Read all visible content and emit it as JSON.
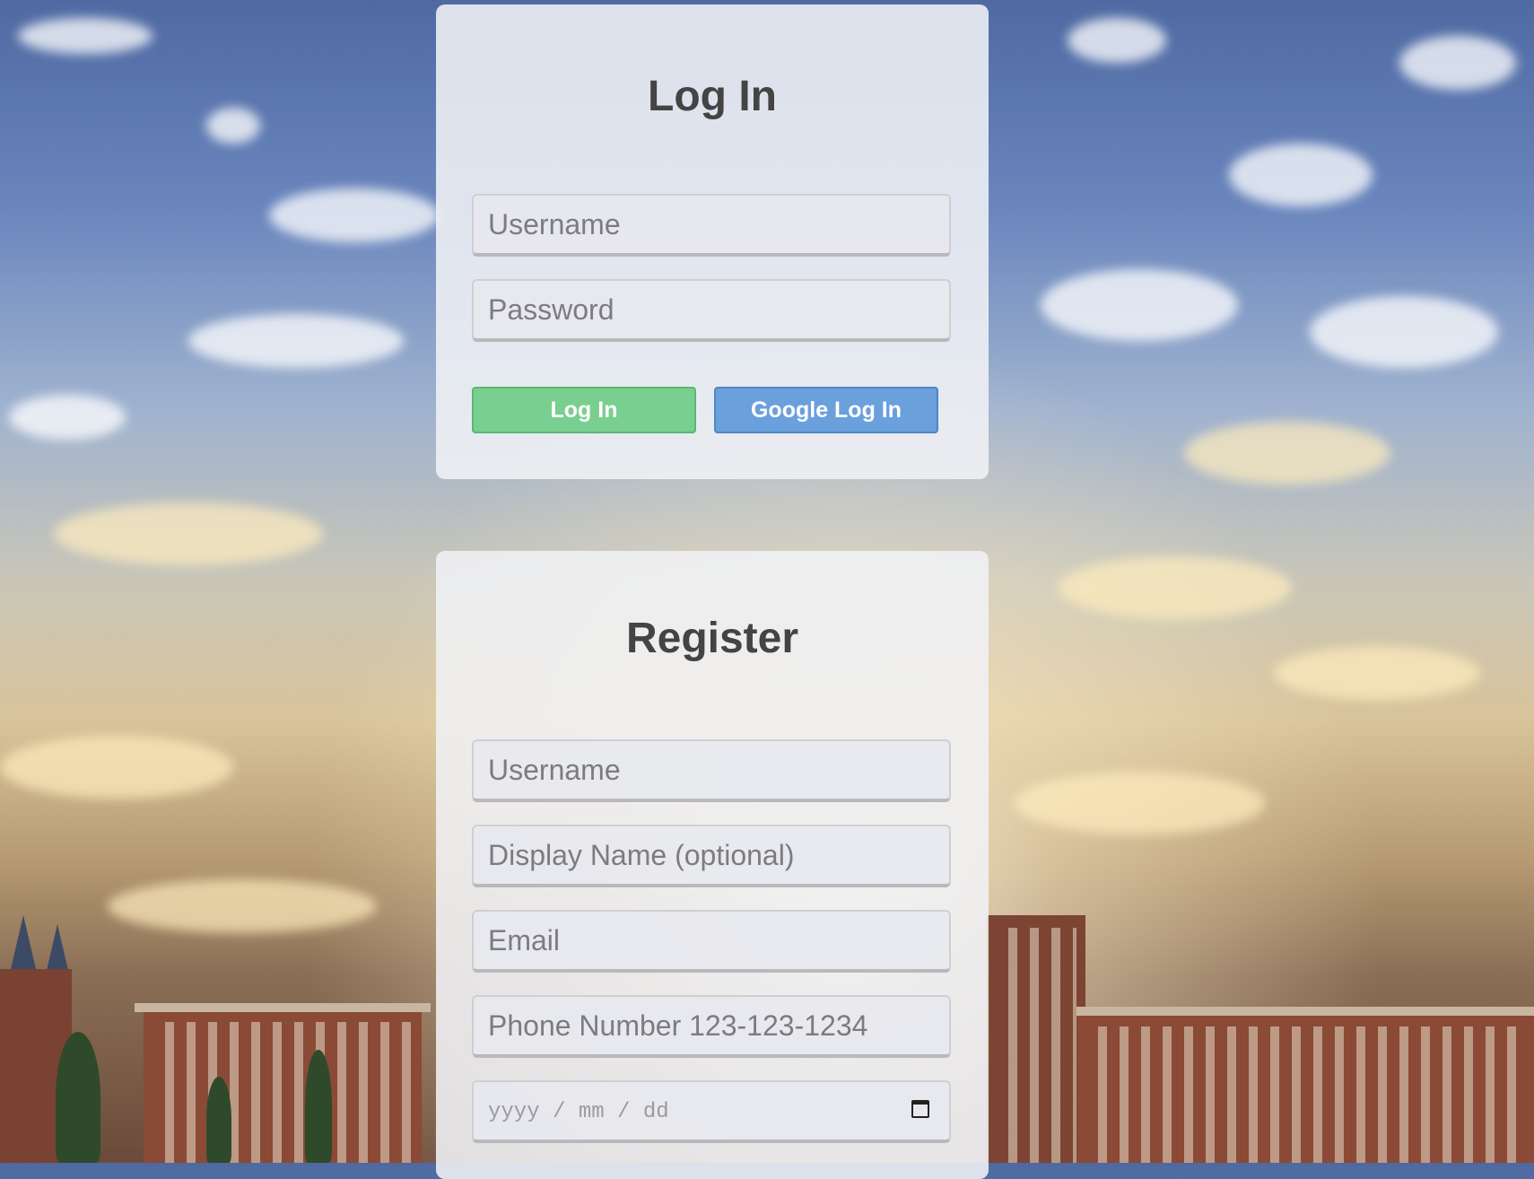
{
  "login": {
    "title": "Log In",
    "username_placeholder": "Username",
    "password_placeholder": "Password",
    "login_button": "Log In",
    "google_button": "Google Log In"
  },
  "register": {
    "title": "Register",
    "username_placeholder": "Username",
    "display_name_placeholder": "Display Name (optional)",
    "email_placeholder": "Email",
    "phone_placeholder": "Phone Number 123-123-1234",
    "date_placeholder": "yyyy / mm / dd",
    "date_icon": "calendar-icon"
  },
  "colors": {
    "login_button": "#79cf8f",
    "google_button": "#6aa0dc",
    "heading": "#444444"
  }
}
